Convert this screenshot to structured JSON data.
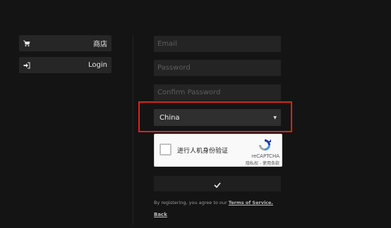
{
  "sidebar": {
    "items": [
      {
        "label": "商店",
        "icon": "cart-icon"
      },
      {
        "label": "Login",
        "icon": "sign-in-icon"
      }
    ]
  },
  "form": {
    "email_placeholder": "Email",
    "password_placeholder": "Password",
    "confirm_placeholder": "Confirm Password",
    "country_value": "China",
    "recaptcha": {
      "label": "进行人机身份验证",
      "brand": "reCAPTCHA",
      "links": "隐私权 - 使用条款"
    },
    "terms_prefix": "By registering, you agree to our ",
    "terms_link": "Terms of Service.",
    "back_label": "Back"
  },
  "colors": {
    "background": "#141414",
    "input_bg": "#242424",
    "highlight": "#e02020"
  }
}
